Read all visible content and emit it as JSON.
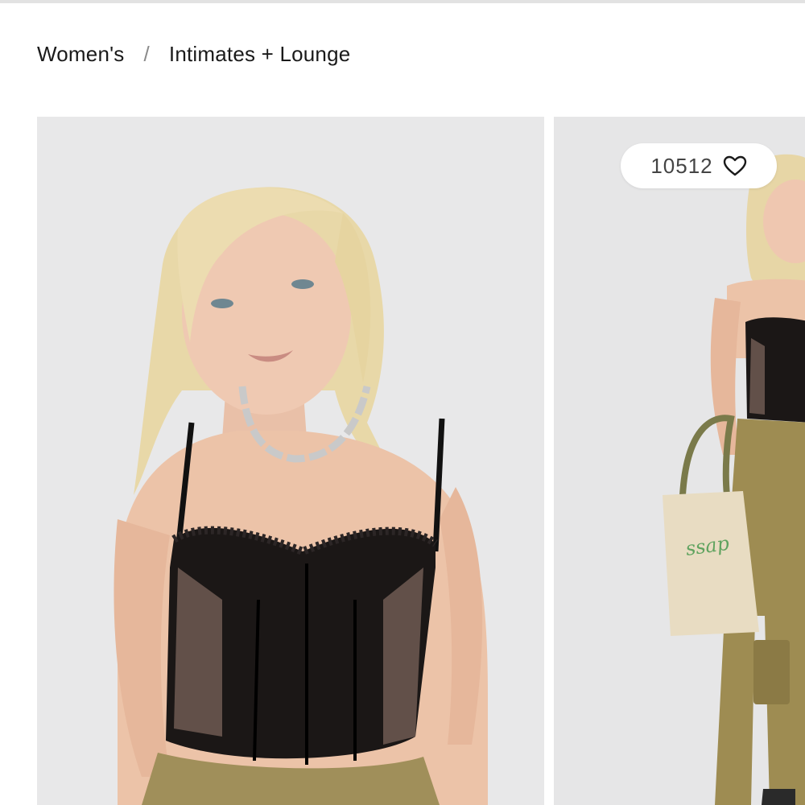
{
  "breadcrumb": {
    "items": [
      {
        "label": "Women's"
      },
      {
        "label": "Intimates + Lounge"
      }
    ],
    "separator": "/"
  },
  "gallery": {
    "images": [
      {
        "alt": "Model wearing black lace corset top with chain necklace"
      },
      {
        "alt": "Model wearing corset top with olive cargo pants holding tote bag"
      }
    ],
    "likes": {
      "count": "10512",
      "icon": "heart-icon"
    }
  },
  "colors": {
    "text": "#1a1a1a",
    "image_bg": "#e9e9ea",
    "pill_bg": "#ffffff"
  }
}
